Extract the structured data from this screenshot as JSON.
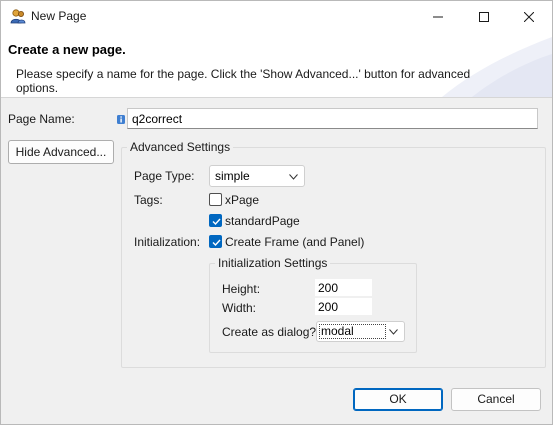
{
  "window": {
    "title": "New Page"
  },
  "header": {
    "title": "Create a new page.",
    "description": "Please specify a name for the page. Click the 'Show Advanced...' button for advanced options."
  },
  "page_name": {
    "label": "Page Name:",
    "value": "q2correct"
  },
  "hide_advanced_label": "Hide Advanced...",
  "advanced": {
    "legend": "Advanced Settings",
    "page_type_label": "Page Type:",
    "page_type_value": "simple",
    "tags_label": "Tags:",
    "tag_xpage": {
      "label": "xPage",
      "checked": false
    },
    "tag_standardpage": {
      "label": "standardPage",
      "checked": true
    },
    "initialization_label": "Initialization:",
    "create_frame": {
      "label": "Create Frame (and Panel)",
      "checked": true
    }
  },
  "init_settings": {
    "legend": "Initialization Settings",
    "height_label": "Height:",
    "height_value": "200",
    "width_label": "Width:",
    "width_value": "200",
    "dialog_label": "Create as dialog?",
    "dialog_value": "modal"
  },
  "buttons": {
    "ok": "OK",
    "cancel": "Cancel"
  },
  "colors": {
    "accent": "#0067c0",
    "info_icon": "#3f7fd1"
  }
}
